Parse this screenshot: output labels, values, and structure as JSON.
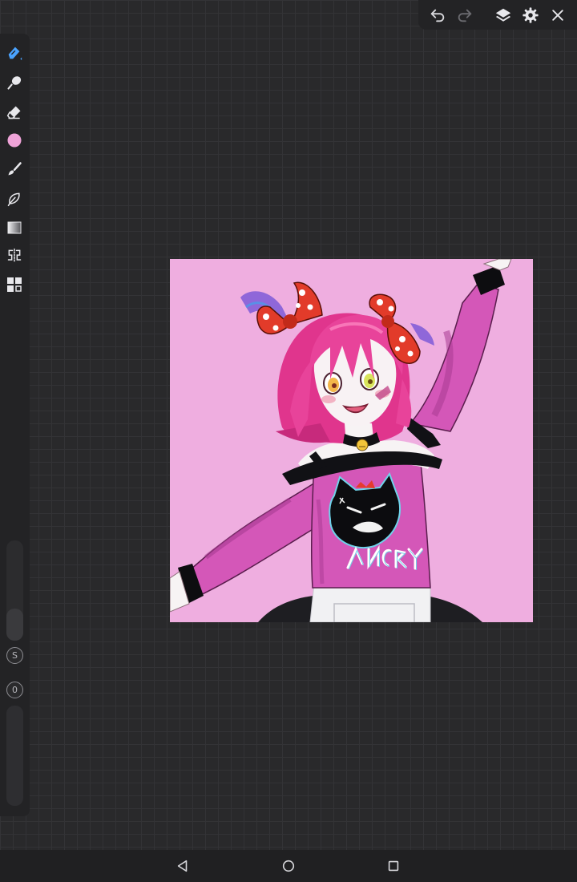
{
  "top_toolbar": {
    "icons": [
      "undo-icon",
      "redo-icon",
      "layers-icon",
      "settings-icon",
      "close-icon"
    ]
  },
  "side_toolbar": {
    "tools": [
      "pen-icon",
      "smudge-icon",
      "eraser-icon",
      "color-swatch",
      "brush-icon",
      "lasso-icon",
      "gradient-icon",
      "symmetry-icon",
      "gallery-icon"
    ],
    "current_color": "#efa3d8",
    "accent_color": "#4aa3ff",
    "size_label": "S",
    "opacity_label": "0"
  },
  "canvas": {
    "background_color": "#efaee0"
  },
  "system_nav": {
    "icons": [
      "back-icon",
      "home-icon",
      "recents-icon"
    ]
  }
}
